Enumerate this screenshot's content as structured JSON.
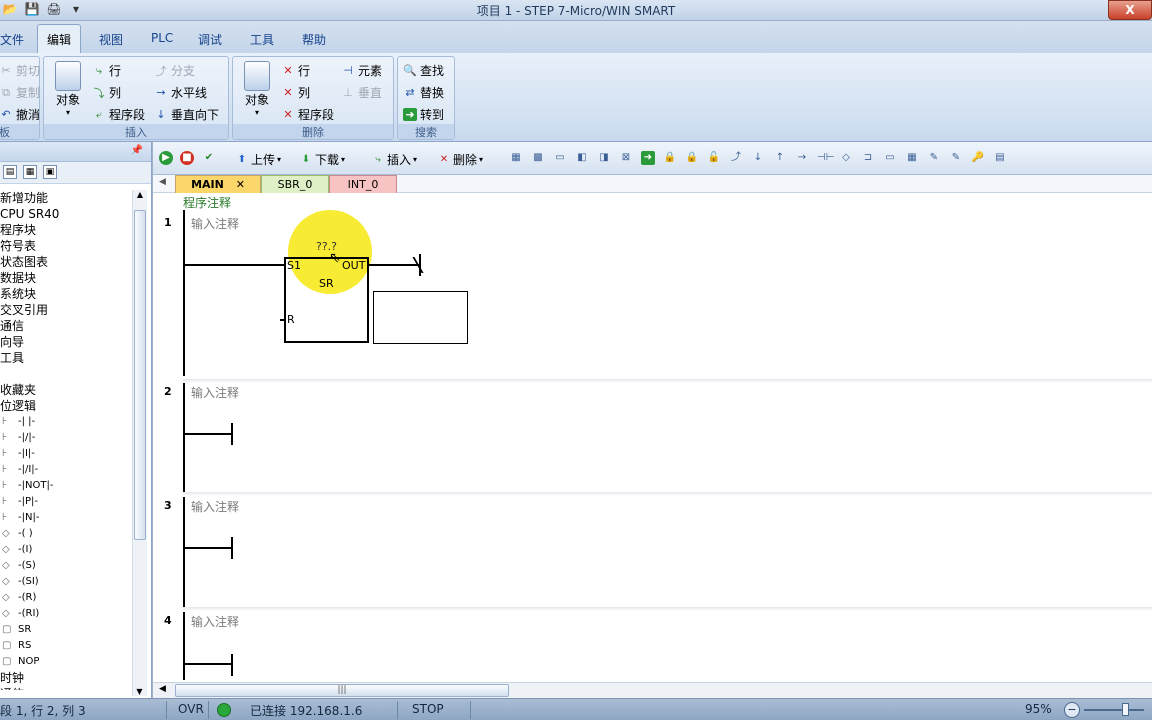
{
  "window": {
    "title": "项目 1 - STEP 7-Micro/WIN SMART",
    "close_label": "X"
  },
  "ribbon_tabs": [
    {
      "label": "文件"
    },
    {
      "label": "编辑"
    },
    {
      "label": "视图"
    },
    {
      "label": "PLC"
    },
    {
      "label": "调试"
    },
    {
      "label": "工具"
    },
    {
      "label": "帮助"
    }
  ],
  "ribbon": {
    "clipboard": {
      "cut": "剪切",
      "copy": "复制",
      "undo": "撤消",
      "title": "板"
    },
    "insert": {
      "object": "对象",
      "row": "行",
      "column": "列",
      "segment": "程序段",
      "branch": "分支",
      "hline": "水平线",
      "vdown": "垂直向下",
      "title": "插入"
    },
    "delete": {
      "object": "对象",
      "row": "行",
      "column": "列",
      "segment": "程序段",
      "element": "元素",
      "vertical": "垂直",
      "title": "删除"
    },
    "search": {
      "find": "查找",
      "replace": "替换",
      "goto": "转到",
      "title": "搜索"
    }
  },
  "tree": {
    "items": [
      "新增功能",
      "CPU SR40",
      "程序块",
      "符号表",
      "状态图表",
      "数据块",
      "系统块",
      "交叉引用",
      "通信",
      "向导",
      "工具",
      "",
      "收藏夹",
      "位逻辑"
    ],
    "sub_items": [
      "-| |-",
      "-|/|-",
      "-|I|-",
      "-|/I|-",
      "-|NOT|-",
      "-|P|-",
      "-|N|-",
      "-( )",
      "-(I)",
      "-(S)",
      "-(SI)",
      "-(R)",
      "-(RI)",
      "SR",
      "RS",
      "NOP"
    ],
    "bottom_items": [
      "时钟",
      "通信"
    ]
  },
  "editor_toolbar": {
    "upload": "上传",
    "download": "下载",
    "insert": "插入",
    "delete": "删除"
  },
  "pou_tabs": [
    {
      "label": "MAIN"
    },
    {
      "label": "SBR_0"
    },
    {
      "label": "INT_0"
    }
  ],
  "program": {
    "comment": "程序注释",
    "networks": [
      {
        "number": "1",
        "comment": "输入注释"
      },
      {
        "number": "2",
        "comment": "输入注释"
      },
      {
        "number": "3",
        "comment": "输入注释"
      },
      {
        "number": "4",
        "comment": "输入注释"
      }
    ],
    "sr_block": {
      "address": "??.?",
      "s_pin": "S1",
      "out_pin": "OUT",
      "name": "SR",
      "r_pin": "R"
    }
  },
  "status": {
    "position": "段 1, 行 2, 列 3",
    "mode": "OVR",
    "connection": "已连接 192.168.1.6",
    "plc_state": "STOP",
    "zoom": "95%"
  },
  "colors": {
    "ribbon_blue": "#15428b",
    "status_green": "#2aa83a",
    "highlight_yellow": "#f5e600"
  }
}
